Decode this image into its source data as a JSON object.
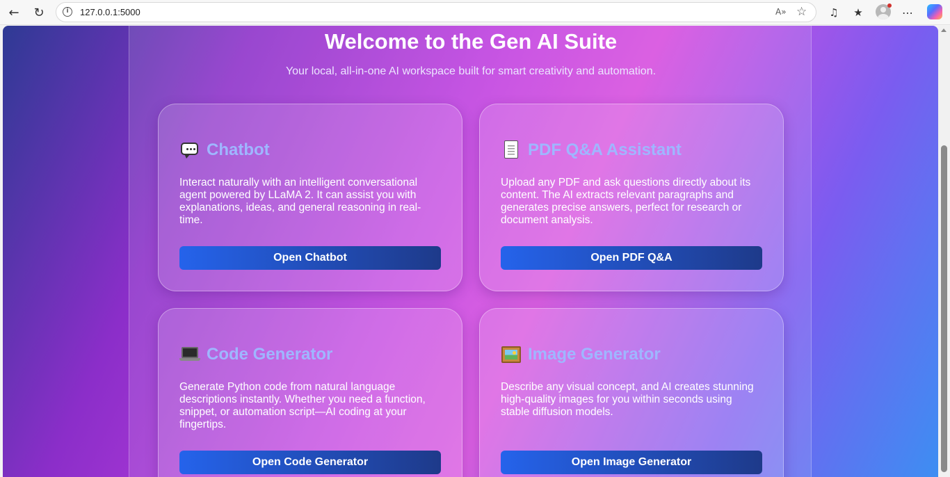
{
  "browser": {
    "url": "127.0.0.1:5000",
    "back_icon": "back-arrow-icon",
    "refresh_icon": "refresh-icon",
    "read_aloud_label": "A»"
  },
  "page": {
    "title": "Welcome to the Gen AI Suite",
    "subtitle": "Your local, all-in-one AI workspace built for smart creativity and automation."
  },
  "cards": [
    {
      "icon": "speech-bubble-icon",
      "title": "Chatbot",
      "description": "Interact naturally with an intelligent conversational agent powered by LLaMA 2. It can assist you with explanations, ideas, and general reasoning in real-time.",
      "button": "Open Chatbot"
    },
    {
      "icon": "document-icon",
      "title": "PDF Q&A Assistant",
      "description": "Upload any PDF and ask questions directly about its content. The AI extracts relevant paragraphs and generates precise answers, perfect for research or document analysis.",
      "button": "Open PDF Q&A"
    },
    {
      "icon": "laptop-icon",
      "title": "Code Generator",
      "description": "Generate Python code from natural language descriptions instantly. Whether you need a function, snippet, or automation script—AI coding at your fingertips.",
      "button": "Open Code Generator"
    },
    {
      "icon": "framed-picture-icon",
      "title": "Image Generator",
      "description": "Describe any visual concept, and AI creates stunning high-quality images for you within seconds using stable diffusion models.",
      "button": "Open Image Generator"
    }
  ],
  "colors": {
    "accent_title": "#9fb6ff",
    "button_start": "#2563eb",
    "button_end": "#1e3a8a"
  }
}
